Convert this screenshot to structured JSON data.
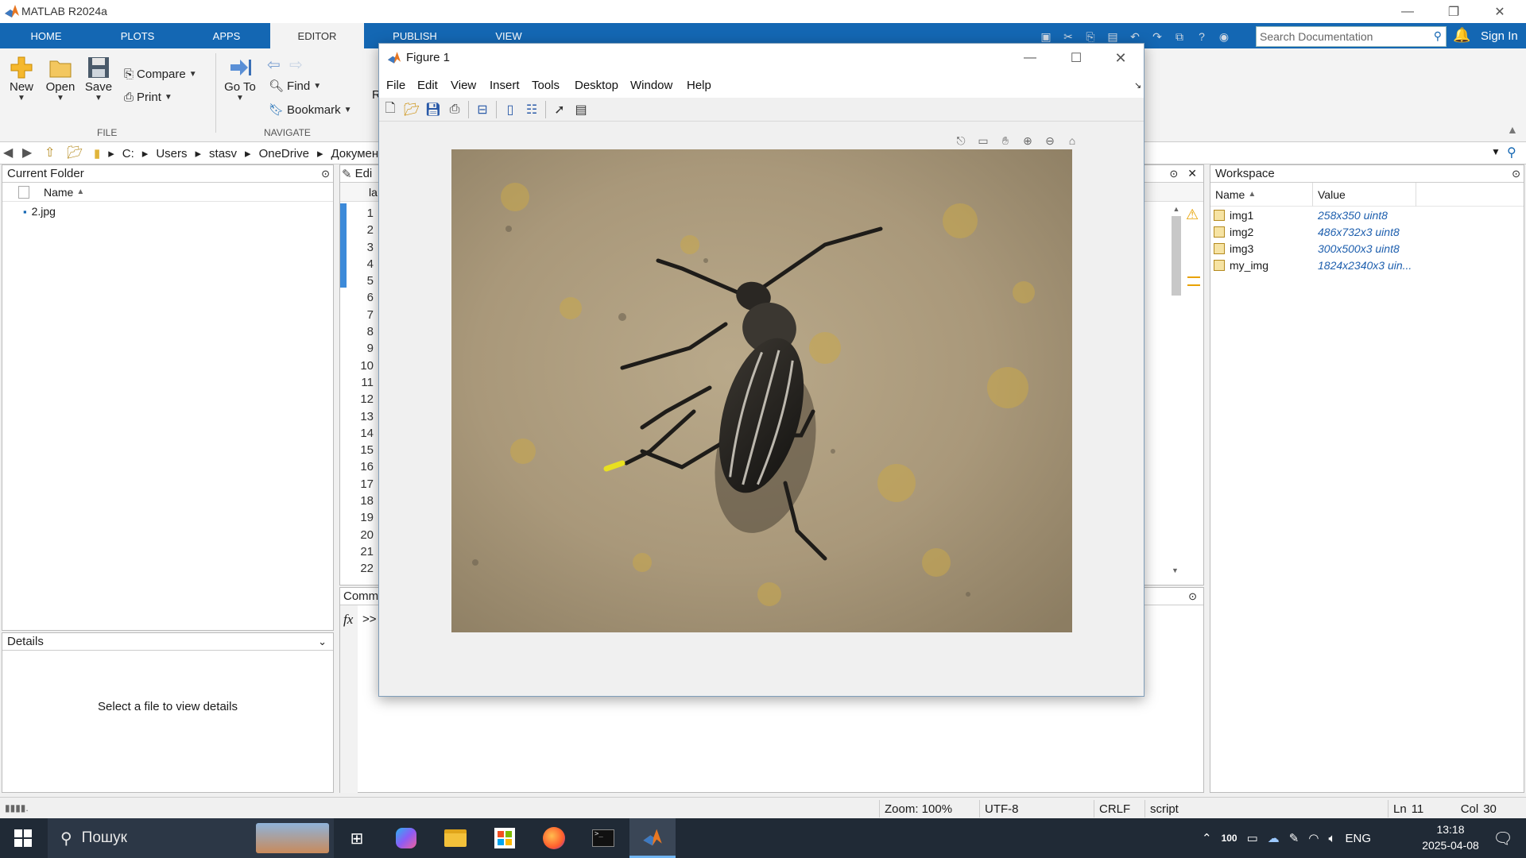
{
  "app": {
    "title": "MATLAB R2024a"
  },
  "tabs": [
    "HOME",
    "PLOTS",
    "APPS",
    "EDITOR",
    "PUBLISH",
    "VIEW"
  ],
  "search": {
    "placeholder": "Search Documentation"
  },
  "signin": "Sign In",
  "ribbon": {
    "file_group": {
      "new": "New",
      "open": "Open",
      "save": "Save",
      "compare": "Compare",
      "print": "Print",
      "label": "FILE"
    },
    "navigate_group": {
      "goto": "Go To",
      "find": "Find",
      "bookmark": "Bookmark",
      "label": "NAVIGATE",
      "cut_letter": "R"
    }
  },
  "address": {
    "crumbs": [
      "C:",
      "Users",
      "stasv",
      "OneDrive",
      "Докумен"
    ]
  },
  "current_folder": {
    "title": "Current Folder",
    "column": "Name",
    "files": [
      "2.jpg"
    ]
  },
  "details": {
    "title": "Details",
    "empty_text": "Select a file to view details"
  },
  "editor": {
    "title_stub": "Edi",
    "tab_stub": "la",
    "line_numbers": [
      "1",
      "2",
      "3",
      "4",
      "5",
      "6",
      "7",
      "8",
      "9",
      "10",
      "11",
      "12",
      "13",
      "14",
      "15",
      "16",
      "17",
      "18",
      "19",
      "20",
      "21",
      "22"
    ]
  },
  "command_window": {
    "title_stub": "Comm",
    "fx": "fx",
    "prompt": ">>"
  },
  "workspace": {
    "title": "Workspace",
    "columns": [
      "Name",
      "Value"
    ],
    "vars": [
      {
        "name": "img1",
        "value": "258x350 uint8"
      },
      {
        "name": "img2",
        "value": "486x732x3 uint8"
      },
      {
        "name": "img3",
        "value": "300x500x3 uint8"
      },
      {
        "name": "my_img",
        "value": "1824x2340x3 uin..."
      }
    ]
  },
  "figure": {
    "title": "Figure 1",
    "menu": [
      "File",
      "Edit",
      "View",
      "Insert",
      "Tools",
      "Desktop",
      "Window",
      "Help"
    ]
  },
  "status": {
    "zoom": "Zoom: 100%",
    "encoding": "UTF-8",
    "eol": "CRLF",
    "type": "script",
    "ln_label": "Ln",
    "ln": "11",
    "col_label": "Col",
    "col": "30"
  },
  "taskbar": {
    "search_text": "Пошук",
    "battery": "100",
    "lang": "ENG",
    "time": "13:18",
    "date": "2025-04-08"
  },
  "colors": {
    "matlab_blue": "#1467b3",
    "taskbar": "#202a36",
    "accent_orange": "#e87722"
  }
}
